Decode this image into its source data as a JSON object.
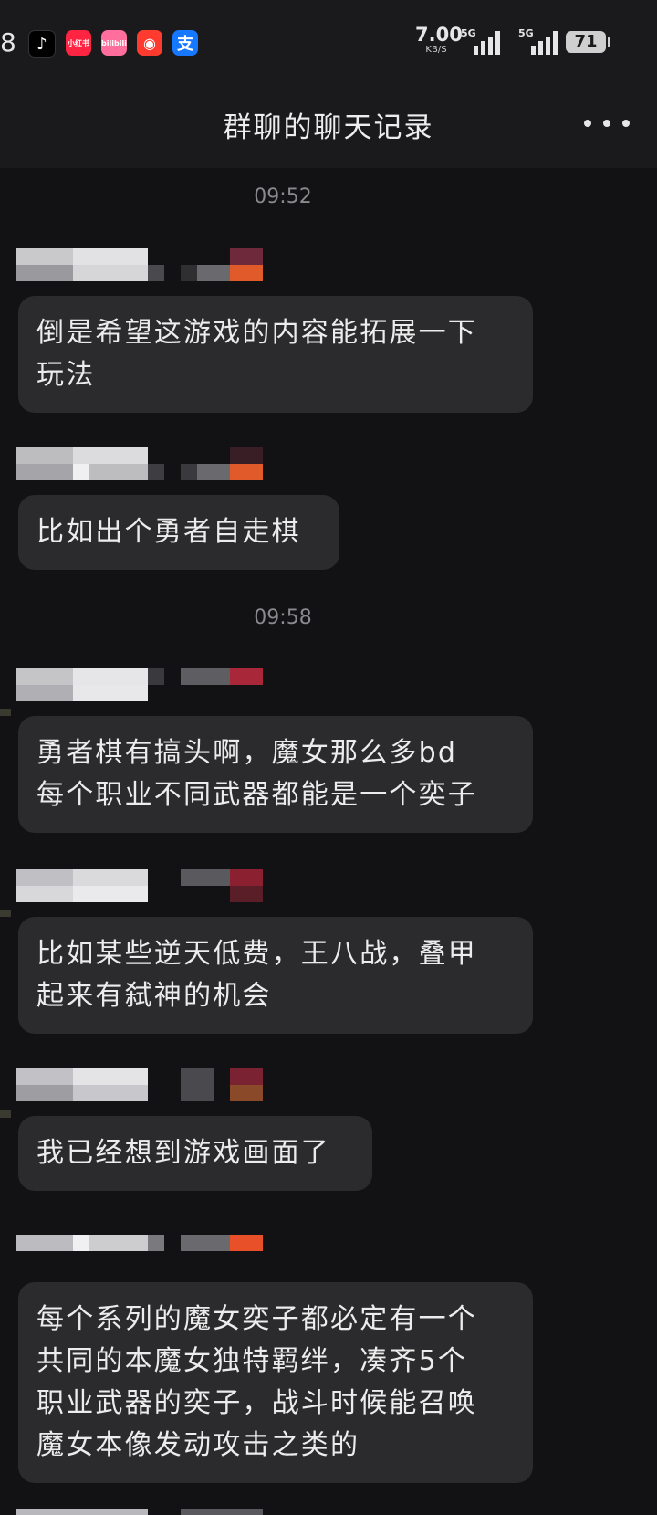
{
  "status_bar": {
    "time_fragment": "8",
    "app_icons": [
      {
        "name": "tiktok-icon",
        "glyph": "♪"
      },
      {
        "name": "xiaohongshu-icon",
        "glyph": "小红书"
      },
      {
        "name": "pink-app-icon",
        "glyph": "bilibili"
      },
      {
        "name": "red-app-icon",
        "glyph": "◉"
      },
      {
        "name": "alipay-icon",
        "glyph": "支"
      }
    ],
    "net_speed": "7.00",
    "net_unit": "KB/S",
    "signal_1": "5G",
    "signal_2": "5G",
    "battery": "71"
  },
  "header": {
    "title": "群聊的聊天记录"
  },
  "chat": {
    "timestamps": [
      "09:52",
      "09:58"
    ],
    "messages": [
      {
        "text": "倒是希望这游戏的内容能拓展一下\n玩法"
      },
      {
        "text": "比如出个勇者自走棋"
      },
      {
        "text": "勇者棋有搞头啊，魔女那么多bd\n每个职业不同武器都能是一个奕子"
      },
      {
        "text": "比如某些逆天低费，王八战，叠甲\n起来有弑神的机会"
      },
      {
        "text": "我已经想到游戏画面了"
      },
      {
        "text": "每个系列的魔女奕子都必定有一个\n共同的本魔女独特羁绊，凑齐5个\n职业武器的奕子，战斗时候能召唤\n魔女本像发动攻击之类的"
      }
    ]
  }
}
